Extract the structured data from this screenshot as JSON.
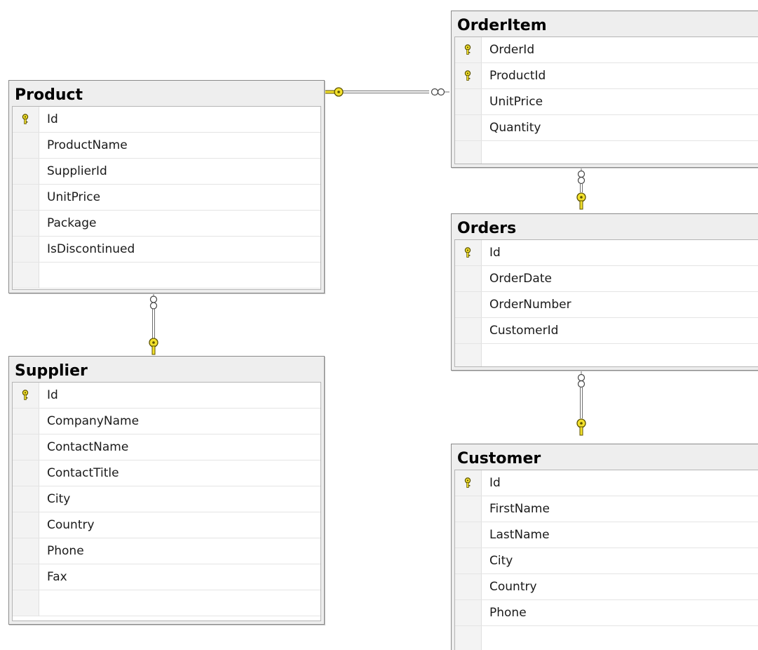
{
  "tables": {
    "product": {
      "name": "Product",
      "columns": [
        {
          "name": "Id",
          "pk": true
        },
        {
          "name": "ProductName",
          "pk": false
        },
        {
          "name": "SupplierId",
          "pk": false
        },
        {
          "name": "UnitPrice",
          "pk": false
        },
        {
          "name": "Package",
          "pk": false
        },
        {
          "name": "IsDiscontinued",
          "pk": false
        }
      ]
    },
    "supplier": {
      "name": "Supplier",
      "columns": [
        {
          "name": "Id",
          "pk": true
        },
        {
          "name": "CompanyName",
          "pk": false
        },
        {
          "name": "ContactName",
          "pk": false
        },
        {
          "name": "ContactTitle",
          "pk": false
        },
        {
          "name": "City",
          "pk": false
        },
        {
          "name": "Country",
          "pk": false
        },
        {
          "name": "Phone",
          "pk": false
        },
        {
          "name": "Fax",
          "pk": false
        }
      ]
    },
    "orderitem": {
      "name": "OrderItem",
      "columns": [
        {
          "name": "OrderId",
          "pk": true
        },
        {
          "name": "ProductId",
          "pk": true
        },
        {
          "name": "UnitPrice",
          "pk": false
        },
        {
          "name": "Quantity",
          "pk": false
        }
      ]
    },
    "orders": {
      "name": "Orders",
      "columns": [
        {
          "name": "Id",
          "pk": true
        },
        {
          "name": "OrderDate",
          "pk": false
        },
        {
          "name": "OrderNumber",
          "pk": false
        },
        {
          "name": "CustomerId",
          "pk": false
        }
      ]
    },
    "customer": {
      "name": "Customer",
      "columns": [
        {
          "name": "Id",
          "pk": true
        },
        {
          "name": "FirstName",
          "pk": false
        },
        {
          "name": "LastName",
          "pk": false
        },
        {
          "name": "City",
          "pk": false
        },
        {
          "name": "Country",
          "pk": false
        },
        {
          "name": "Phone",
          "pk": false
        }
      ]
    }
  },
  "relationships": [
    {
      "from": "Product",
      "to": "OrderItem"
    },
    {
      "from": "Supplier",
      "to": "Product"
    },
    {
      "from": "Orders",
      "to": "OrderItem"
    },
    {
      "from": "Customer",
      "to": "Orders"
    }
  ],
  "colors": {
    "key_fill": "#f2e02c",
    "key_stroke": "#5c5200",
    "connector": "#6f6f6f"
  }
}
